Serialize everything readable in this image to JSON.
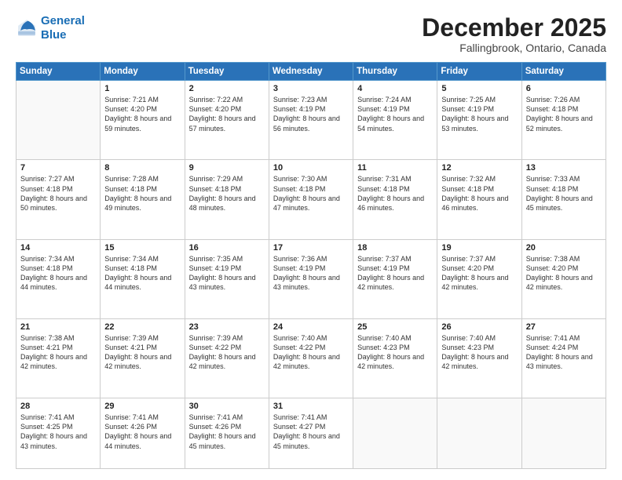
{
  "logo": {
    "line1": "General",
    "line2": "Blue"
  },
  "header": {
    "month": "December 2025",
    "location": "Fallingbrook, Ontario, Canada"
  },
  "weekdays": [
    "Sunday",
    "Monday",
    "Tuesday",
    "Wednesday",
    "Thursday",
    "Friday",
    "Saturday"
  ],
  "weeks": [
    [
      {
        "day": "",
        "sunrise": "",
        "sunset": "",
        "daylight": ""
      },
      {
        "day": "1",
        "sunrise": "Sunrise: 7:21 AM",
        "sunset": "Sunset: 4:20 PM",
        "daylight": "Daylight: 8 hours and 59 minutes."
      },
      {
        "day": "2",
        "sunrise": "Sunrise: 7:22 AM",
        "sunset": "Sunset: 4:20 PM",
        "daylight": "Daylight: 8 hours and 57 minutes."
      },
      {
        "day": "3",
        "sunrise": "Sunrise: 7:23 AM",
        "sunset": "Sunset: 4:19 PM",
        "daylight": "Daylight: 8 hours and 56 minutes."
      },
      {
        "day": "4",
        "sunrise": "Sunrise: 7:24 AM",
        "sunset": "Sunset: 4:19 PM",
        "daylight": "Daylight: 8 hours and 54 minutes."
      },
      {
        "day": "5",
        "sunrise": "Sunrise: 7:25 AM",
        "sunset": "Sunset: 4:19 PM",
        "daylight": "Daylight: 8 hours and 53 minutes."
      },
      {
        "day": "6",
        "sunrise": "Sunrise: 7:26 AM",
        "sunset": "Sunset: 4:18 PM",
        "daylight": "Daylight: 8 hours and 52 minutes."
      }
    ],
    [
      {
        "day": "7",
        "sunrise": "Sunrise: 7:27 AM",
        "sunset": "Sunset: 4:18 PM",
        "daylight": "Daylight: 8 hours and 50 minutes."
      },
      {
        "day": "8",
        "sunrise": "Sunrise: 7:28 AM",
        "sunset": "Sunset: 4:18 PM",
        "daylight": "Daylight: 8 hours and 49 minutes."
      },
      {
        "day": "9",
        "sunrise": "Sunrise: 7:29 AM",
        "sunset": "Sunset: 4:18 PM",
        "daylight": "Daylight: 8 hours and 48 minutes."
      },
      {
        "day": "10",
        "sunrise": "Sunrise: 7:30 AM",
        "sunset": "Sunset: 4:18 PM",
        "daylight": "Daylight: 8 hours and 47 minutes."
      },
      {
        "day": "11",
        "sunrise": "Sunrise: 7:31 AM",
        "sunset": "Sunset: 4:18 PM",
        "daylight": "Daylight: 8 hours and 46 minutes."
      },
      {
        "day": "12",
        "sunrise": "Sunrise: 7:32 AM",
        "sunset": "Sunset: 4:18 PM",
        "daylight": "Daylight: 8 hours and 46 minutes."
      },
      {
        "day": "13",
        "sunrise": "Sunrise: 7:33 AM",
        "sunset": "Sunset: 4:18 PM",
        "daylight": "Daylight: 8 hours and 45 minutes."
      }
    ],
    [
      {
        "day": "14",
        "sunrise": "Sunrise: 7:34 AM",
        "sunset": "Sunset: 4:18 PM",
        "daylight": "Daylight: 8 hours and 44 minutes."
      },
      {
        "day": "15",
        "sunrise": "Sunrise: 7:34 AM",
        "sunset": "Sunset: 4:18 PM",
        "daylight": "Daylight: 8 hours and 44 minutes."
      },
      {
        "day": "16",
        "sunrise": "Sunrise: 7:35 AM",
        "sunset": "Sunset: 4:19 PM",
        "daylight": "Daylight: 8 hours and 43 minutes."
      },
      {
        "day": "17",
        "sunrise": "Sunrise: 7:36 AM",
        "sunset": "Sunset: 4:19 PM",
        "daylight": "Daylight: 8 hours and 43 minutes."
      },
      {
        "day": "18",
        "sunrise": "Sunrise: 7:37 AM",
        "sunset": "Sunset: 4:19 PM",
        "daylight": "Daylight: 8 hours and 42 minutes."
      },
      {
        "day": "19",
        "sunrise": "Sunrise: 7:37 AM",
        "sunset": "Sunset: 4:20 PM",
        "daylight": "Daylight: 8 hours and 42 minutes."
      },
      {
        "day": "20",
        "sunrise": "Sunrise: 7:38 AM",
        "sunset": "Sunset: 4:20 PM",
        "daylight": "Daylight: 8 hours and 42 minutes."
      }
    ],
    [
      {
        "day": "21",
        "sunrise": "Sunrise: 7:38 AM",
        "sunset": "Sunset: 4:21 PM",
        "daylight": "Daylight: 8 hours and 42 minutes."
      },
      {
        "day": "22",
        "sunrise": "Sunrise: 7:39 AM",
        "sunset": "Sunset: 4:21 PM",
        "daylight": "Daylight: 8 hours and 42 minutes."
      },
      {
        "day": "23",
        "sunrise": "Sunrise: 7:39 AM",
        "sunset": "Sunset: 4:22 PM",
        "daylight": "Daylight: 8 hours and 42 minutes."
      },
      {
        "day": "24",
        "sunrise": "Sunrise: 7:40 AM",
        "sunset": "Sunset: 4:22 PM",
        "daylight": "Daylight: 8 hours and 42 minutes."
      },
      {
        "day": "25",
        "sunrise": "Sunrise: 7:40 AM",
        "sunset": "Sunset: 4:23 PM",
        "daylight": "Daylight: 8 hours and 42 minutes."
      },
      {
        "day": "26",
        "sunrise": "Sunrise: 7:40 AM",
        "sunset": "Sunset: 4:23 PM",
        "daylight": "Daylight: 8 hours and 42 minutes."
      },
      {
        "day": "27",
        "sunrise": "Sunrise: 7:41 AM",
        "sunset": "Sunset: 4:24 PM",
        "daylight": "Daylight: 8 hours and 43 minutes."
      }
    ],
    [
      {
        "day": "28",
        "sunrise": "Sunrise: 7:41 AM",
        "sunset": "Sunset: 4:25 PM",
        "daylight": "Daylight: 8 hours and 43 minutes."
      },
      {
        "day": "29",
        "sunrise": "Sunrise: 7:41 AM",
        "sunset": "Sunset: 4:26 PM",
        "daylight": "Daylight: 8 hours and 44 minutes."
      },
      {
        "day": "30",
        "sunrise": "Sunrise: 7:41 AM",
        "sunset": "Sunset: 4:26 PM",
        "daylight": "Daylight: 8 hours and 45 minutes."
      },
      {
        "day": "31",
        "sunrise": "Sunrise: 7:41 AM",
        "sunset": "Sunset: 4:27 PM",
        "daylight": "Daylight: 8 hours and 45 minutes."
      },
      {
        "day": "",
        "sunrise": "",
        "sunset": "",
        "daylight": ""
      },
      {
        "day": "",
        "sunrise": "",
        "sunset": "",
        "daylight": ""
      },
      {
        "day": "",
        "sunrise": "",
        "sunset": "",
        "daylight": ""
      }
    ]
  ]
}
